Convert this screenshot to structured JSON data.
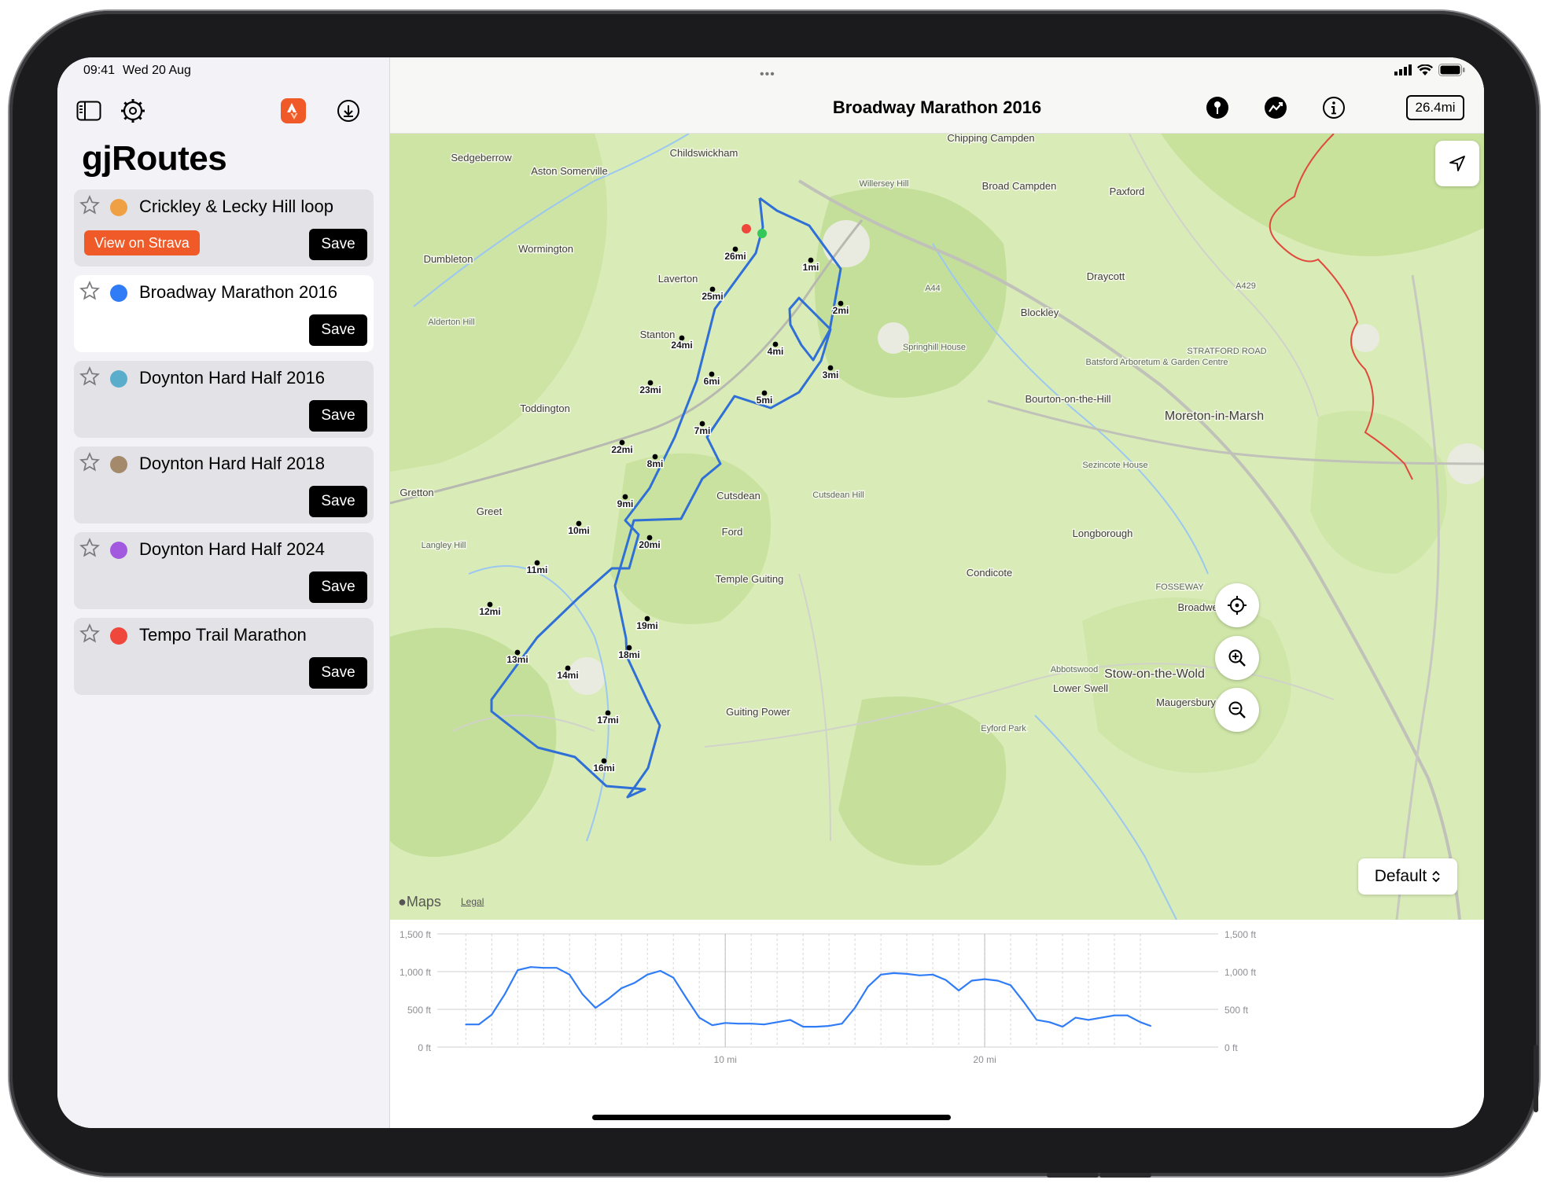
{
  "status": {
    "time": "09:41",
    "date": "Wed 20 Aug"
  },
  "app": {
    "title": "gjRoutes"
  },
  "routes": [
    {
      "name": "Crickley & Lecky Hill loop",
      "color": "#f0a044",
      "strava_label": "View on Strava",
      "save_label": "Save"
    },
    {
      "name": "Broadway Marathon 2016",
      "color": "#2f7cf6",
      "save_label": "Save",
      "selected": true
    },
    {
      "name": "Doynton Hard Half 2016",
      "color": "#5aaecb",
      "save_label": "Save"
    },
    {
      "name": "Doynton Hard Half 2018",
      "color": "#a48a6a",
      "save_label": "Save"
    },
    {
      "name": "Doynton Hard Half 2024",
      "color": "#a259e0",
      "save_label": "Save"
    },
    {
      "name": "Tempo Trail Marathon",
      "color": "#f0473c",
      "save_label": "Save"
    }
  ],
  "header": {
    "title": "Broadway Marathon 2016",
    "distance": "26.4mi"
  },
  "map": {
    "style": "Default",
    "logo": "Maps",
    "legal": "Legal",
    "route_color": "#2f6fd6",
    "places": [
      "Childswickham",
      "Sedgeberrow",
      "Aston Somerville",
      "Willersey Hill",
      "Chipping Campden",
      "Broad Campden",
      "Paxford",
      "Dumbleton",
      "Wormington",
      "Laverton",
      "Draycott",
      "A44",
      "A429",
      "Blockley",
      "Alderton Hill",
      "Stanton",
      "Springhill House",
      "Batsford Arboretum & Garden Centre",
      "STRATFORD ROAD",
      "Toddington",
      "Bourton-on-the-Hill",
      "Moreton-in-Marsh",
      "Sezincote House",
      "Gretton",
      "Greet",
      "Cutsdean",
      "Cutsdean Hill",
      "Ford",
      "Longborough",
      "Langley Hill",
      "Temple Guiting",
      "Condicote",
      "FOSSEWAY",
      "Broadwell",
      "Abbotswood",
      "Stow-on-the-Wold",
      "Lower Swell",
      "Maugersbury",
      "Guiting Power",
      "Eyford Park"
    ],
    "mile_markers": [
      "1mi",
      "2mi",
      "3mi",
      "4mi",
      "5mi",
      "6mi",
      "7mi",
      "8mi",
      "9mi",
      "10mi",
      "11mi",
      "12mi",
      "13mi",
      "14mi",
      "16mi",
      "17mi",
      "18mi",
      "19mi",
      "20mi",
      "22mi",
      "23mi",
      "24mi",
      "25mi",
      "26mi"
    ]
  },
  "chart_data": {
    "type": "line",
    "title": "",
    "xlabel": "",
    "ylabel": "",
    "x_ticks": [
      "10 mi",
      "20 mi"
    ],
    "y_ticks": [
      "1,500 ft",
      "1,000 ft",
      "500 ft",
      "0 ft"
    ],
    "xlim": [
      -1.1,
      29.0
    ],
    "ylim": [
      0,
      1500
    ],
    "series": [
      {
        "color": "#2f7cf6",
        "x": [
          0,
          0.5,
          1,
          1.5,
          2,
          2.5,
          3,
          3.5,
          4,
          4.5,
          5,
          5.5,
          6,
          6.5,
          7,
          7.5,
          8,
          8.5,
          9,
          9.5,
          10,
          10.5,
          11,
          11.5,
          12,
          12.5,
          13,
          13.5,
          14,
          14.5,
          15,
          15.5,
          16,
          16.5,
          17,
          17.5,
          18,
          18.5,
          19,
          19.5,
          20,
          20.5,
          21,
          21.5,
          22,
          22.5,
          23,
          23.5,
          24,
          24.5,
          25,
          25.5,
          26,
          26.4
        ],
        "y": [
          300,
          300,
          430,
          700,
          1020,
          1060,
          1050,
          1050,
          960,
          700,
          520,
          640,
          780,
          850,
          960,
          1010,
          920,
          650,
          390,
          290,
          320,
          310,
          310,
          300,
          330,
          360,
          270,
          270,
          280,
          310,
          520,
          800,
          960,
          980,
          970,
          950,
          960,
          890,
          750,
          880,
          900,
          880,
          820,
          600,
          360,
          330,
          270,
          390,
          360,
          390,
          420,
          420,
          330,
          280
        ]
      }
    ]
  }
}
